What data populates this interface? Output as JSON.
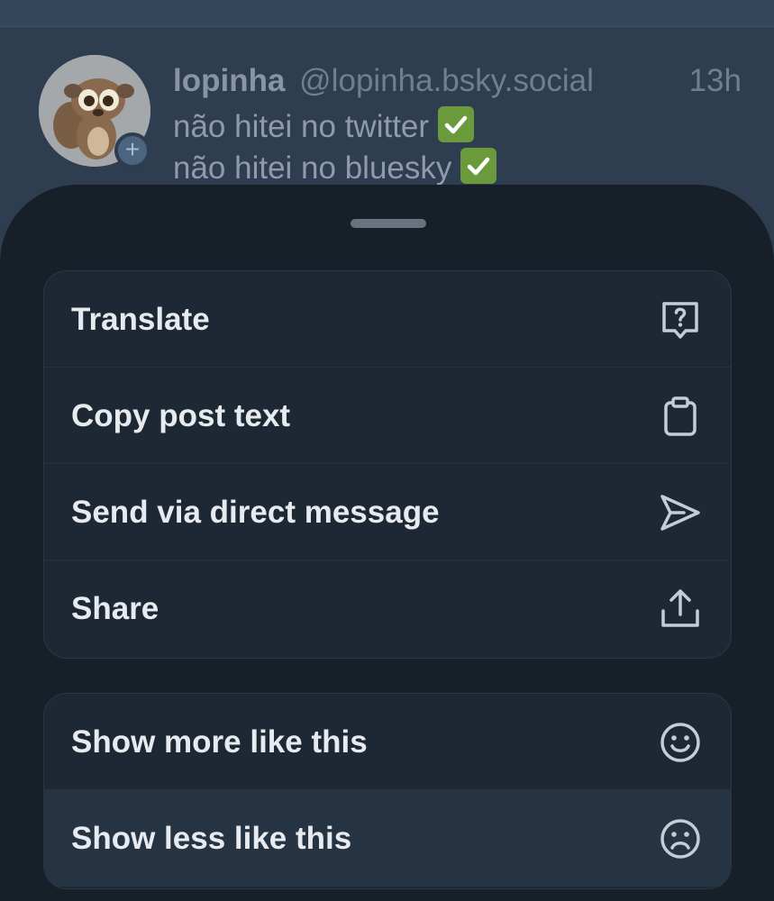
{
  "post": {
    "author_name": "lopinha",
    "author_handle": "@lopinha.bsky.social",
    "time": "13h",
    "line1": "não hitei no twitter",
    "line2": "não hitei no bluesky",
    "follow_symbol": "+",
    "avatar_icon": "lemur-avatar",
    "check_icon": "check-mark-emoji",
    "check_color": "#6a9a3c"
  },
  "menu": {
    "group1": [
      {
        "label": "Translate",
        "icon": "translate-icon"
      },
      {
        "label": "Copy post text",
        "icon": "clipboard-icon"
      },
      {
        "label": "Send via direct message",
        "icon": "send-icon"
      },
      {
        "label": "Share",
        "icon": "share-icon"
      }
    ],
    "group2": [
      {
        "label": "Show more like this",
        "icon": "smile-icon"
      },
      {
        "label": "Show less like this",
        "icon": "frown-icon"
      }
    ]
  },
  "colors": {
    "sheet_bg": "#171f29",
    "group_bg": "#1e2834",
    "highlight_bg": "#253343",
    "text": "#e7ebef",
    "icon": "#c5ccd3"
  }
}
